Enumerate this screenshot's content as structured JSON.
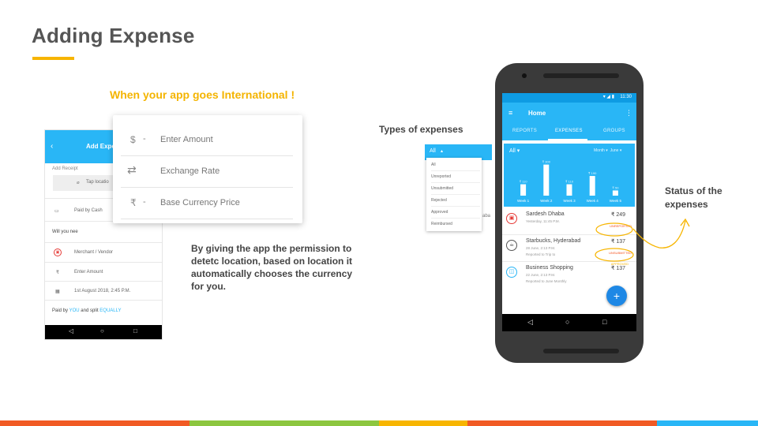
{
  "slide": {
    "title": "Adding Expense",
    "subtitle": "When your app goes International !",
    "description": "By giving the app the permission to detetc location, based on location it automatically chooses the currency for you.",
    "types_label": "Types of expenses",
    "status_label": "Status of the expenses"
  },
  "colors": {
    "accent": "#f7b500",
    "app_blue": "#29b6f6",
    "status_orange": "#f4511e",
    "footer": [
      "#f15a24",
      "#8cc63f",
      "#f7b500",
      "#f15a24",
      "#29b6f6"
    ]
  },
  "left_phone": {
    "title": "Add Expe",
    "add_receipt": "Add Receipt",
    "tap_location": "Tap locatio",
    "paid_by": "Paid by Cash",
    "will_you_need": "Will you nee",
    "merchant": "Merchant / Vendor",
    "enter_amount": "Enter Amount",
    "date": "1st August 2018, 2:45 P.M.",
    "paid_by_you_prefix": "Paid by",
    "you": "YOU",
    "and_split": "and split",
    "equally": "EQUALLY"
  },
  "popup": {
    "amount_symbol": "$",
    "amount_label": "Enter Amount",
    "exchange_label": "Exchange Rate",
    "base_symbol": "₹",
    "base_label": "Base Currency Price"
  },
  "types": {
    "header": "All",
    "items": [
      "All",
      "Unreported",
      "Unsubmitted",
      "Rejected",
      "Approved",
      "Reimbursed"
    ],
    "tail": "aba"
  },
  "app": {
    "time": "11:30",
    "title": "Home",
    "tabs": [
      "REPORTS",
      "EXPENSES",
      "GROUPS"
    ],
    "filter_all": "All",
    "filter_month": "Month",
    "filter_value": "June",
    "expenses": [
      {
        "name": "Sardesh Dhaba",
        "date": "Yesterday, 11:45 P.M.",
        "report": "",
        "amount": "₹ 249",
        "status": "UNREPORTED"
      },
      {
        "name": "Starbucks, Hyderabad",
        "date": "28 June, 2:13 P.M.",
        "report": "Reported to Trip to",
        "amount": "₹ 137",
        "status": "UNSUBMITTED"
      },
      {
        "name": "Business Shopping",
        "date": "22 June, 2:13 P.M.",
        "report": "Reported to June Monthly",
        "amount": "₹ 137",
        "status": "APPROVED"
      }
    ]
  },
  "chart_data": {
    "type": "bar",
    "categories": [
      "Week 1",
      "Week 2",
      "Week 3",
      "Week 4",
      "Week 5"
    ],
    "values": [
      110,
      300,
      110,
      190,
      50
    ],
    "data_labels": [
      "₹ 110",
      "₹ 300",
      "₹ 110",
      "₹ 190",
      "₹ 50"
    ],
    "ylim": [
      0,
      320
    ]
  }
}
